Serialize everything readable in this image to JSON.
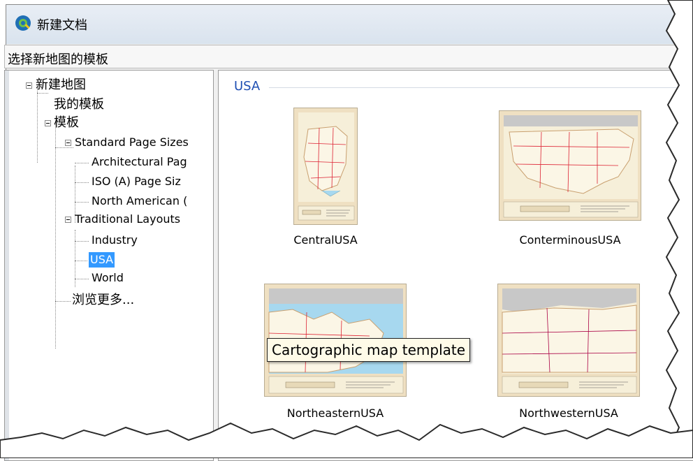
{
  "window": {
    "title": "新建文档",
    "icon": "qgis-globe-icon"
  },
  "header": {
    "text": "选择新地图的模板"
  },
  "tree": {
    "root": "新建地图",
    "my_templates": "我的模板",
    "templates": "模板",
    "standard_page_sizes": "Standard Page Sizes",
    "architectural": "Architectural Pag",
    "iso": "ISO (A) Page Siz",
    "north_american": "North American (",
    "traditional_layouts": "Traditional Layouts",
    "industry": "Industry",
    "usa": "USA",
    "world": "World",
    "browse_more": "浏览更多..."
  },
  "content": {
    "group_title": "USA",
    "templates": [
      {
        "label": "CentralUSA"
      },
      {
        "label": "ConterminousUSA"
      },
      {
        "label": "NortheasternUSA"
      },
      {
        "label": "NorthwesternUSA"
      }
    ],
    "tooltip": "Cartographic map template"
  },
  "colors": {
    "selection": "#3399ff",
    "group_title": "#1f4fb3",
    "map_paper": "#efe0c2",
    "water": "#a7d8ef"
  }
}
